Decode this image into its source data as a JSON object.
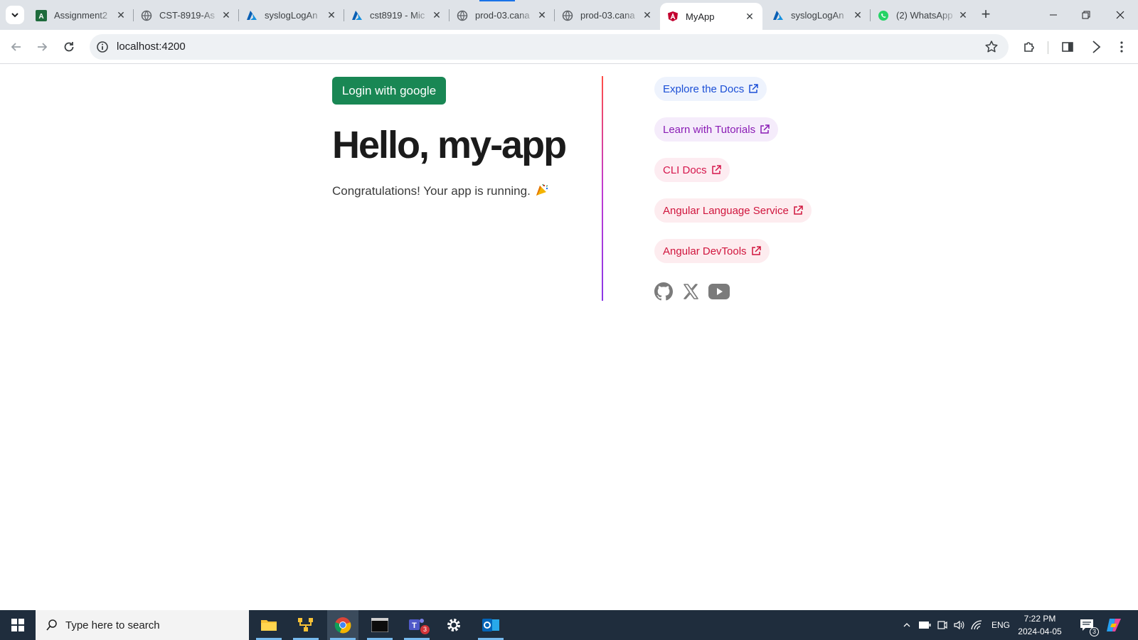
{
  "browser": {
    "tabs": [
      {
        "title": "Assignment2",
        "icon": "acrobat-icon"
      },
      {
        "title": "CST-8919-As",
        "icon": "globe-icon"
      },
      {
        "title": "syslogLogAn",
        "icon": "azure-icon"
      },
      {
        "title": "cst8919 - Mic",
        "icon": "azure-icon"
      },
      {
        "title": "prod-03.cana",
        "icon": "globe-icon"
      },
      {
        "title": "prod-03.cana",
        "icon": "globe-icon"
      },
      {
        "title": "MyApp",
        "icon": "angular-icon",
        "active": true
      },
      {
        "title": "syslogLogAn",
        "icon": "azure-icon"
      },
      {
        "title": "(2) WhatsApp",
        "icon": "whatsapp-icon"
      }
    ],
    "url": "localhost:4200"
  },
  "page": {
    "login_label": "Login with google",
    "heading": "Hello, my-app",
    "subtitle": "Congratulations! Your app is running.",
    "links": [
      {
        "label": "Explore the Docs"
      },
      {
        "label": "Learn with Tutorials"
      },
      {
        "label": "CLI Docs"
      },
      {
        "label": "Angular Language Service"
      },
      {
        "label": "Angular DevTools"
      }
    ],
    "social": [
      "github-icon",
      "x-icon",
      "youtube-icon"
    ]
  },
  "taskbar": {
    "search_placeholder": "Type here to search",
    "language": "ENG",
    "time": "7:22 PM",
    "date": "2024-04-05",
    "notification_count": "3",
    "teams_badge": "3"
  },
  "colors": {
    "login_button": "#198754",
    "accent_blue": "#1b4fd6",
    "accent_purple": "#8a1cb5",
    "accent_pink": "#d0153d",
    "taskbar": "#1f2d3d"
  }
}
